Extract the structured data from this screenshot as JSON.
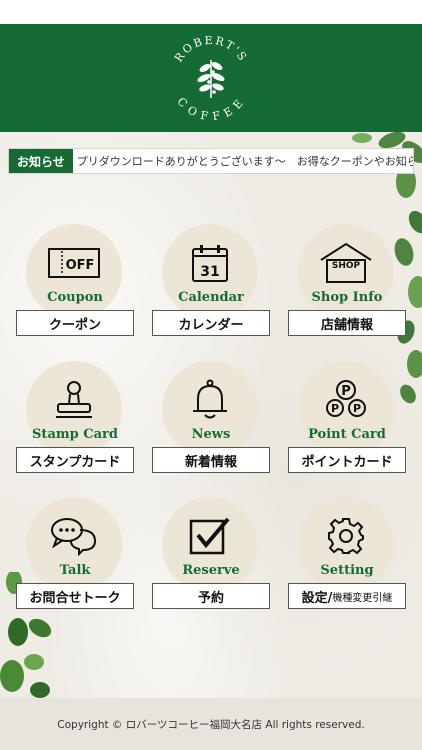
{
  "header": {
    "logo_top": "ROBERT'S",
    "logo_bottom": "COFFEE",
    "brand_color": "#166b35"
  },
  "ticker": {
    "badge": "お知らせ",
    "text": "プリダウンロードありがとうございます〜　お得なクーポンやお知らせを受け"
  },
  "tiles": [
    {
      "en": "Coupon",
      "jp": "クーポン",
      "icon": "coupon-off-icon",
      "icon_text": "OFF"
    },
    {
      "en": "Calendar",
      "jp": "カレンダー",
      "icon": "calendar-icon",
      "icon_text": "31"
    },
    {
      "en": "Shop Info",
      "jp": "店舗情報",
      "icon": "shop-icon",
      "icon_text": "SHOP"
    },
    {
      "en": "Stamp Card",
      "jp": "スタンプカード",
      "icon": "stamp-icon"
    },
    {
      "en": "News",
      "jp": "新着情報",
      "icon": "bell-icon"
    },
    {
      "en": "Point Card",
      "jp": "ポイントカード",
      "icon": "points-icon",
      "icon_text": "P"
    },
    {
      "en": "Talk",
      "jp": "お問合せトーク",
      "icon": "chat-icon"
    },
    {
      "en": "Reserve",
      "jp": "予約",
      "icon": "checkbox-icon"
    },
    {
      "en": "Setting",
      "jp_main": "設定/",
      "jp_small": "機種変更引継",
      "icon": "gear-icon"
    }
  ],
  "footer": {
    "copyright": "Copyright © ロバーツコーヒー福岡大名店 All rights reserved."
  }
}
